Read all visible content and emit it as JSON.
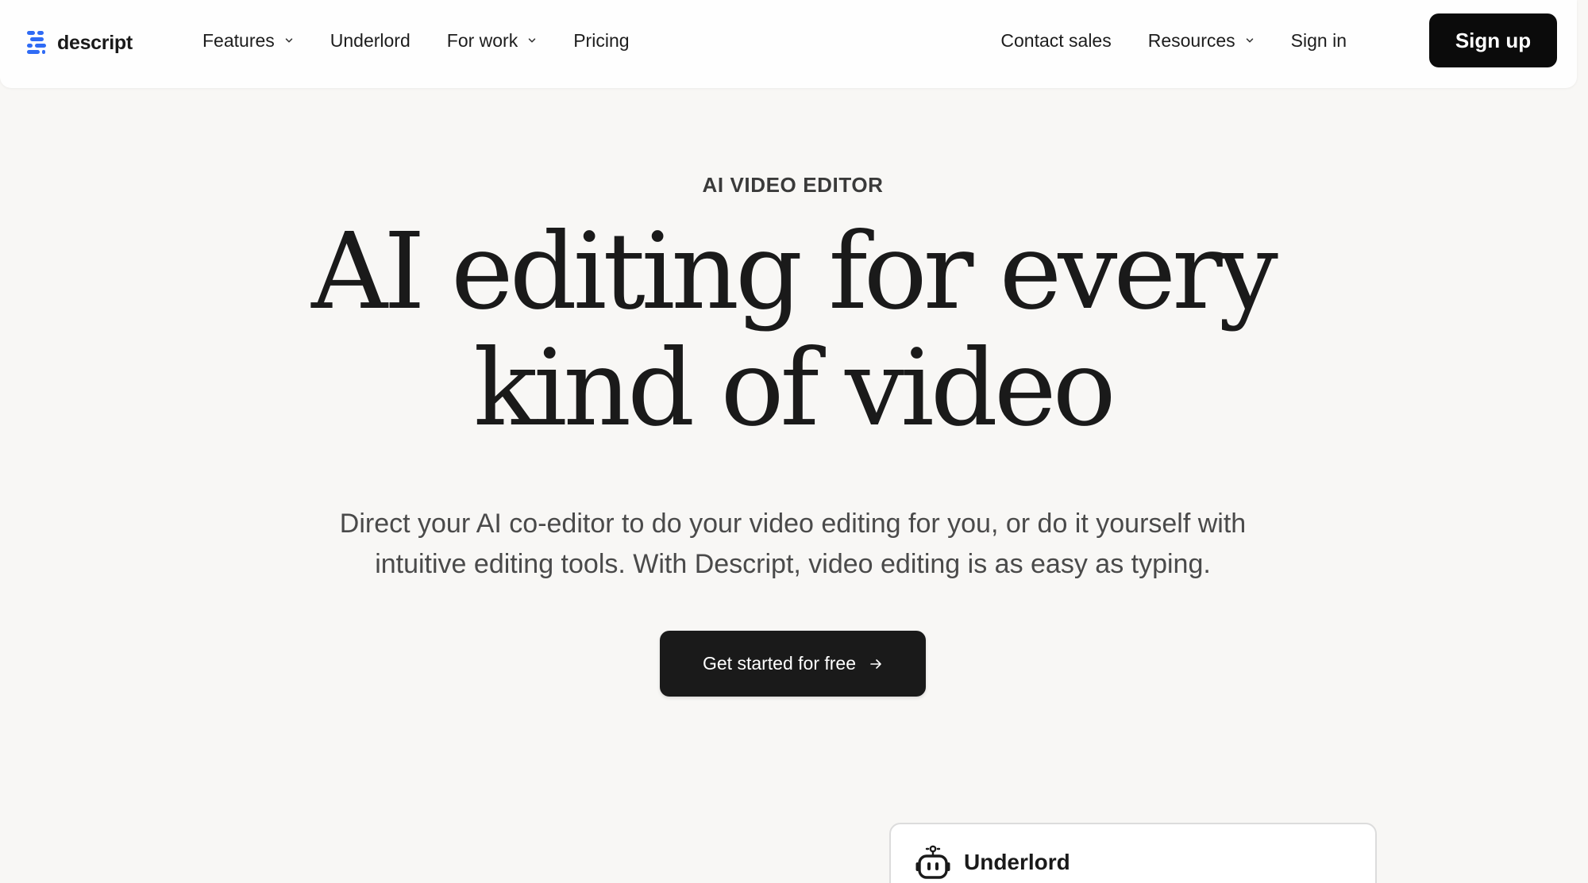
{
  "brand": {
    "name": "descript",
    "logo_icon": "descript-logo-icon",
    "accent_color": "#2f6bf5"
  },
  "nav": {
    "left": [
      {
        "label": "Features",
        "dropdown": true
      },
      {
        "label": "Underlord",
        "dropdown": false
      },
      {
        "label": "For work",
        "dropdown": true
      },
      {
        "label": "Pricing",
        "dropdown": false
      }
    ],
    "right": [
      {
        "label": "Contact sales",
        "dropdown": false
      },
      {
        "label": "Resources",
        "dropdown": true
      },
      {
        "label": "Sign in",
        "dropdown": false
      }
    ],
    "signup_label": "Sign up"
  },
  "hero": {
    "eyebrow": "AI VIDEO EDITOR",
    "headline_lines": [
      "AI editing for every",
      "kind of video"
    ],
    "subtext_lines": [
      "Direct your AI co-editor to do your video editing for you, or do it yourself with",
      "intuitive editing tools. With Descript, video editing is as easy as typing."
    ],
    "cta_label": "Get started for free",
    "cta_icon": "arrow-right-icon"
  },
  "card": {
    "title": "Underlord",
    "icon": "robot-icon"
  },
  "colors": {
    "background": "#f8f7f5",
    "nav_background": "#fefefe",
    "button_dark": "#0b0b0b",
    "text_primary": "#1a1a1a",
    "text_secondary": "#4a4a4a"
  }
}
